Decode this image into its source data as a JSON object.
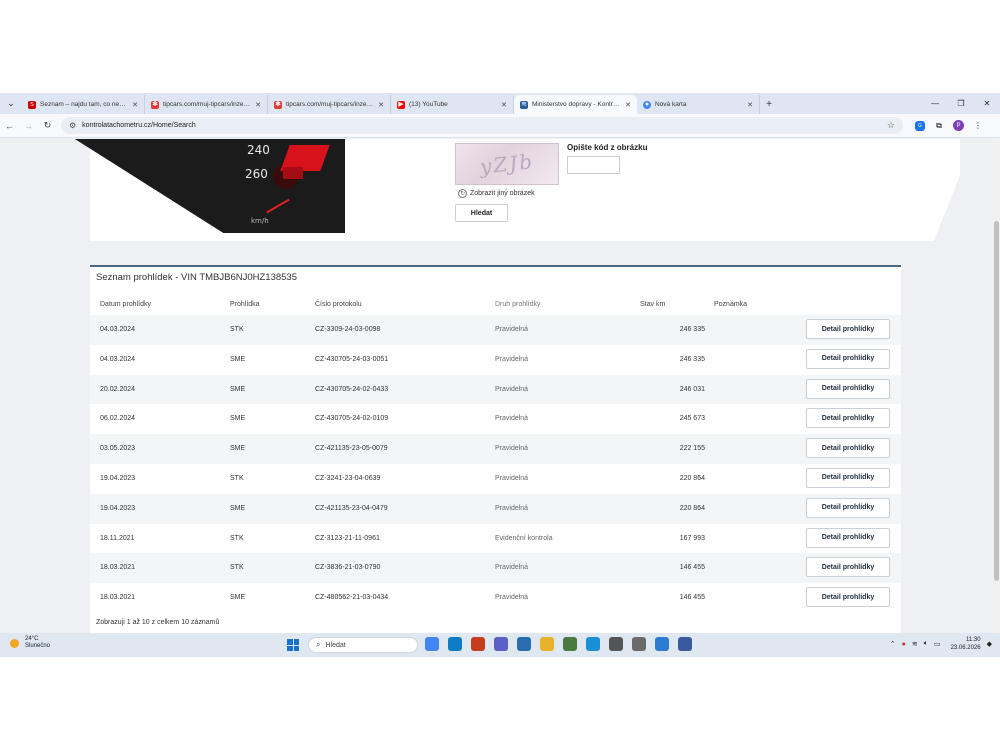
{
  "browser": {
    "tabs": [
      {
        "label": "Seznam – najdu tam, co neznám",
        "icon": "seznam-icon",
        "color": "#cc0000"
      },
      {
        "label": "tipcars.com/muj-tipcars/inzerce",
        "icon": "tipcars-icon",
        "color": "#e03a3a"
      },
      {
        "label": "tipcars.com/muj-tipcars/inzerce",
        "icon": "tipcars-icon",
        "color": "#e03a3a"
      },
      {
        "label": "(13) YouTube",
        "icon": "youtube-icon",
        "color": "#ff0000"
      },
      {
        "label": "Ministerstvo dopravy - Kontrola",
        "icon": "ministry-icon",
        "color": "#2a5aa0",
        "active": true
      },
      {
        "label": "Nová karta",
        "icon": "chrome-icon",
        "color": "#4285f4"
      }
    ],
    "url": "kontrolatachometru.cz/Home/Search"
  },
  "captcha": {
    "image_text": "yZJb",
    "refresh_label": "Zobrazit jiný obrázek",
    "code_label": "Opište kód z obrázku",
    "code_value": "",
    "search_button": "Hledat"
  },
  "speedometer": {
    "labels": [
      "240",
      "260"
    ],
    "unit": "km/h"
  },
  "inspections": {
    "title": "Seznam prohlídek - VIN TMBJB6NJ0HZ138535",
    "columns": {
      "date": "Datum prohlídky",
      "type": "Prohlídka",
      "protocol": "Číslo protokolu",
      "kind": "Druh prohlídky",
      "km": "Stav km",
      "note": "Poznámka"
    },
    "detail_label": "Detail prohlídky",
    "rows": [
      {
        "date": "04.03.2024",
        "type": "STK",
        "protocol": "CZ-3309-24-03-0098",
        "kind": "Pravidelná",
        "km": "246 335"
      },
      {
        "date": "04.03.2024",
        "type": "SME",
        "protocol": "CZ-430705-24-03-0051",
        "kind": "Pravidelná",
        "km": "246 335"
      },
      {
        "date": "20.02.2024",
        "type": "SME",
        "protocol": "CZ-430705-24-02-0433",
        "kind": "Pravidelná",
        "km": "246 031"
      },
      {
        "date": "06.02.2024",
        "type": "SME",
        "protocol": "CZ-430705-24-02-0109",
        "kind": "Pravidelná",
        "km": "245 673"
      },
      {
        "date": "03.05.2023",
        "type": "SME",
        "protocol": "CZ-421135-23-05-0079",
        "kind": "Pravidelná",
        "km": "222 155"
      },
      {
        "date": "19.04.2023",
        "type": "STK",
        "protocol": "CZ-3241-23-04-0639",
        "kind": "Pravidelná",
        "km": "220 864"
      },
      {
        "date": "19.04.2023",
        "type": "SME",
        "protocol": "CZ-421135-23-04-0479",
        "kind": "Pravidelná",
        "km": "220 864"
      },
      {
        "date": "18.11.2021",
        "type": "STK",
        "protocol": "CZ-3123-21-11-0961",
        "kind": "Evidenční kontrola",
        "km": "167 993"
      },
      {
        "date": "18.03.2021",
        "type": "STK",
        "protocol": "CZ-3836-21-03-0790",
        "kind": "Pravidelná",
        "km": "146 455"
      },
      {
        "date": "18.03.2021",
        "type": "SME",
        "protocol": "CZ-480562-21-03-0434",
        "kind": "Pravidelná",
        "km": "146 455"
      }
    ],
    "footer": "Zobrazuji 1 až 10 z celkem 10 záznamů"
  },
  "taskbar": {
    "weather_temp": "24°C",
    "weather_desc": "Slunečno",
    "search_placeholder": "Hledat",
    "time": "11:30",
    "date": "23.06.2026",
    "apps": [
      {
        "icon": "chrome-icon",
        "color": "#4285f4"
      },
      {
        "icon": "edge-icon",
        "color": "#0f7bc5"
      },
      {
        "icon": "powerpoint-icon",
        "color": "#c43e1c"
      },
      {
        "icon": "teams-icon",
        "color": "#5b5fc7"
      },
      {
        "icon": "store-icon",
        "color": "#2b6cb0"
      },
      {
        "icon": "folder-icon",
        "color": "#e8b32a"
      },
      {
        "icon": "app-icon",
        "color": "#4a7a3d"
      },
      {
        "icon": "edge-browser-icon",
        "color": "#1a8fd6"
      },
      {
        "icon": "game-icon",
        "color": "#555555"
      },
      {
        "icon": "tool-icon",
        "color": "#6a6a6a"
      },
      {
        "icon": "network-icon",
        "color": "#2c7dd1"
      },
      {
        "icon": "snip-icon",
        "color": "#3a5aa0"
      }
    ]
  }
}
